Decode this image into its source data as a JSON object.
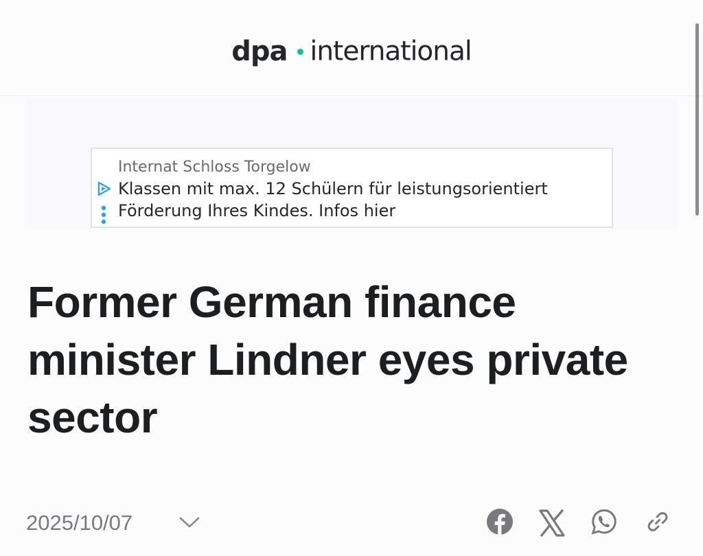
{
  "header": {
    "logo_brand": "dpa",
    "logo_sub": "international"
  },
  "ad": {
    "advertiser": "Internat Schloss Torgelow",
    "line1": "Klassen mit max. 12 Schülern für leistungsorientiert",
    "line2": "Förderung Ihres Kindes. Infos hier"
  },
  "article": {
    "headline": "Former German finance minister Lindner eyes private sector",
    "date": "2025/10/07"
  },
  "colors": {
    "accent_dot": "#12c48a",
    "text_primary": "#1d1e20",
    "text_muted": "#7a7a7e"
  },
  "icons": {
    "share": [
      "facebook-icon",
      "x-icon",
      "whatsapp-icon",
      "link-icon"
    ],
    "expand": "chevron-down-icon"
  }
}
